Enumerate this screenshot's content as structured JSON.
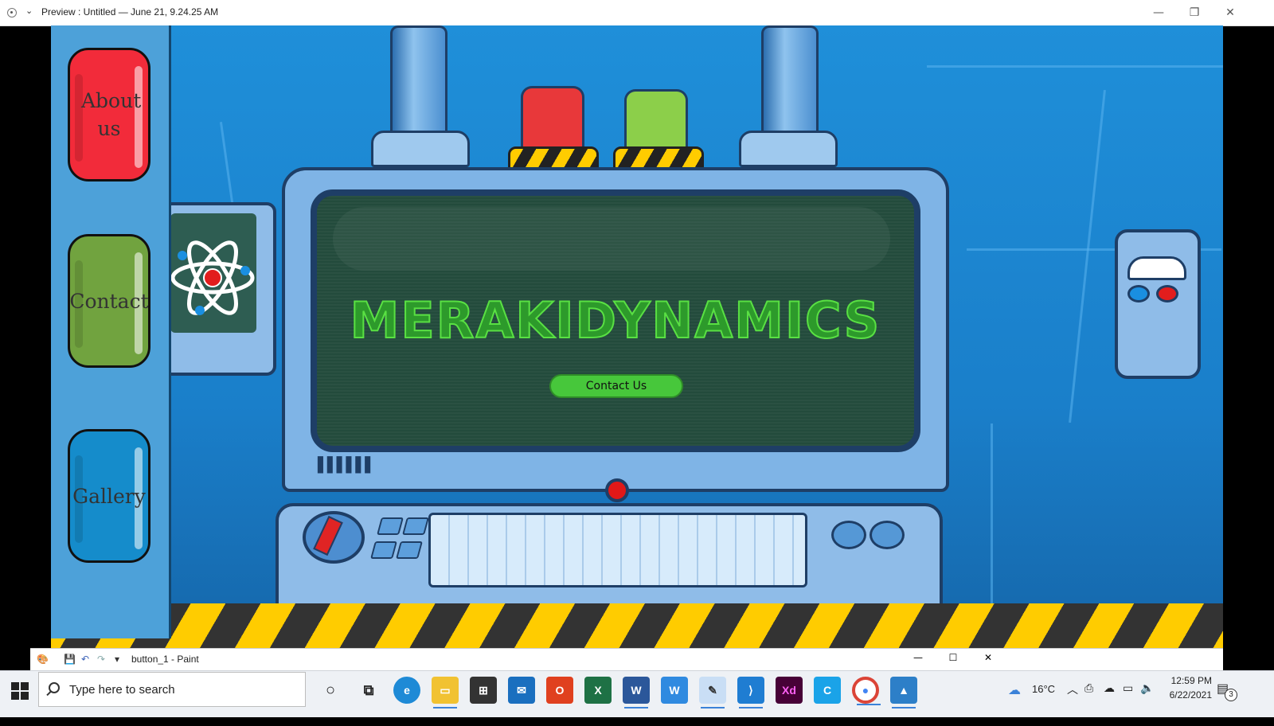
{
  "window": {
    "title": "Preview : Untitled — June 21, 9.24.25 AM",
    "minimize": "—",
    "restore": "❐",
    "close": "✕"
  },
  "sidebar": {
    "items": [
      {
        "label": "About us",
        "color": "#f22b3a"
      },
      {
        "label": "Contact",
        "color": "#71a33f"
      },
      {
        "label": "Gallery",
        "color": "#158ccb"
      }
    ]
  },
  "hero": {
    "brand": "MERAKIDYNAMICS",
    "cta_label": "Contact Us",
    "accent": "#47c73b"
  },
  "paint": {
    "title": "button_1 - Paint",
    "minimize": "—",
    "maximize": "☐",
    "close": "✕"
  },
  "taskbar": {
    "search_placeholder": "Type here to search",
    "apps": [
      "cortana-icon",
      "task-view-icon",
      "edge-icon",
      "file-explorer-icon",
      "store-icon",
      "mail-icon",
      "office-icon",
      "excel-icon",
      "word-icon",
      "writer-icon",
      "paint-icon",
      "vscode-icon",
      "xd-icon",
      "c-app-icon",
      "chrome-icon",
      "photos-icon"
    ],
    "weather": "16°C",
    "time": "12:59 PM",
    "date": "6/22/2021",
    "notification_count": "3"
  }
}
